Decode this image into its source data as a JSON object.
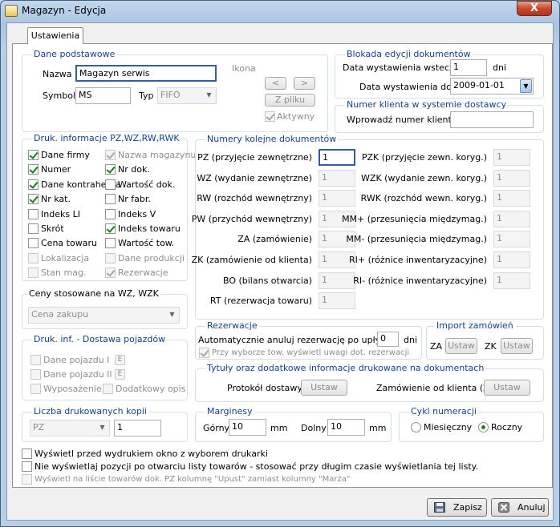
{
  "window": {
    "title": "Magazyn - Edycja",
    "close": "X"
  },
  "tab": "Ustawienia",
  "basic": {
    "title": "Dane podstawowe",
    "name_label": "Nazwa",
    "name_value": "Magazyn serwis",
    "symbol_label": "Symbol",
    "symbol_value": "MS",
    "type_label": "Typ",
    "type_value": "FIFO",
    "icon_label": "Ikona",
    "prev": "<",
    "next": ">",
    "from_file": "Z pliku",
    "active": "Aktywny"
  },
  "lock": {
    "title": "Blokada edycji dokumentów",
    "back_label": "Data wystawienia wstecz",
    "back_value": "1",
    "days": "dni",
    "until_label": "Data wystawienia do",
    "until_value": "2009-01-01"
  },
  "client_no": {
    "title": "Numer klienta w systemie dostawcy",
    "label": "Wprowadź numer klienta",
    "value": ""
  },
  "print_info": {
    "title": "Druk. informacje PZ,WZ,RW,RWK",
    "items": [
      "Dane firmy",
      "Nazwa magazynu",
      "Numer",
      "Nr dok.",
      "Dane kontrahenta",
      "Wartość dok.",
      "Nr kat.",
      "Nr fabr.",
      "Indeks LI",
      "Indeks V",
      "Skrót",
      "Indeks towaru",
      "Cena towaru",
      "Wartość tow.",
      "Lokalizacja",
      "Dane produkcji",
      "Stan mag.",
      "Rezerwacje"
    ]
  },
  "numbering": {
    "title": "Numery kolejne dokumentów",
    "left": [
      {
        "label": "PZ (przyjęcie zewnętrzne)",
        "value": "1"
      },
      {
        "label": "WZ (wydanie zewnętrzne)",
        "value": "1"
      },
      {
        "label": "RW (rozchód wewnętrzny)",
        "value": "1"
      },
      {
        "label": "PW (przychód wewnętrzny)",
        "value": "1"
      },
      {
        "label": "ZA (zamówienie)",
        "value": "1"
      },
      {
        "label": "ZK (zamówienie od klienta)",
        "value": "1"
      },
      {
        "label": "BO (bilans otwarcia)",
        "value": "1"
      },
      {
        "label": "RT (rezerwacja towaru)",
        "value": "1"
      }
    ],
    "right": [
      {
        "label": "PZK (przyjęcie zewn. koryg.)",
        "value": "1"
      },
      {
        "label": "WZK (wydanie zewn. koryg.)",
        "value": "1"
      },
      {
        "label": "RWK (rozchód wewn. koryg.)",
        "value": "1"
      },
      {
        "label": "MM+ (przesunięcia międzymag.)",
        "value": "1"
      },
      {
        "label": "MM- (przesunięcia międzymag.)",
        "value": "1"
      },
      {
        "label": "RI+ (różnice inwentaryzacyjne)",
        "value": "1"
      },
      {
        "label": "RI- (różnice inwentaryzacyjne)",
        "value": "1"
      }
    ]
  },
  "prices": {
    "title": "Ceny stosowane na WZ, WZK",
    "value": "Cena zakupu"
  },
  "vehicle": {
    "title": "Druk. inf. - Dostawa pojazdów",
    "data1": "Dane pojazdu I",
    "data2": "Dane pojazdu II",
    "equipment": "Wyposażenie",
    "extra": "Dodatkowy opis",
    "e": "E"
  },
  "copies": {
    "title": "Liczba drukowanych kopii",
    "type": "PZ",
    "value": "1"
  },
  "reservation": {
    "title": "Rezerwacje",
    "auto_label": "Automatycznie anuluj rezerwację po upływie",
    "auto_value": "0",
    "days": "dni",
    "show_notes": "Przy wyborze tow. wyświetl uwagi dot. rezerwacji"
  },
  "import": {
    "title": "Import zamówień",
    "za": "ZA",
    "zk": "ZK",
    "set": "Ustaw"
  },
  "titles": {
    "title": "Tytuły oraz dodatkowe informacje drukowane na dokumentach",
    "protocol": "Protokół dostawy",
    "order": "Zamówienie od klienta (ZK)",
    "set": "Ustaw"
  },
  "margins": {
    "title": "Marginesy",
    "top_label": "Górny",
    "top_value": "10",
    "unit": "mm",
    "bottom_label": "Dolny",
    "bottom_value": "10"
  },
  "cycle": {
    "title": "Cykl numeracji",
    "monthly": "Miesięczny",
    "yearly": "Roczny"
  },
  "options": [
    "Wyświetl przed wydrukiem okno z wyborem drukarki",
    "Nie wyświetlaj pozycji po otwarciu listy towarów -  stosować przy długim czasie wyświetlania tej listy.",
    "Wyświetl na liście towarów dok. PZ kolumnę \"Upust\" zamiast kolumny \"Marża\""
  ],
  "buttons": {
    "save": "Zapisz",
    "cancel": "Anuluj"
  }
}
